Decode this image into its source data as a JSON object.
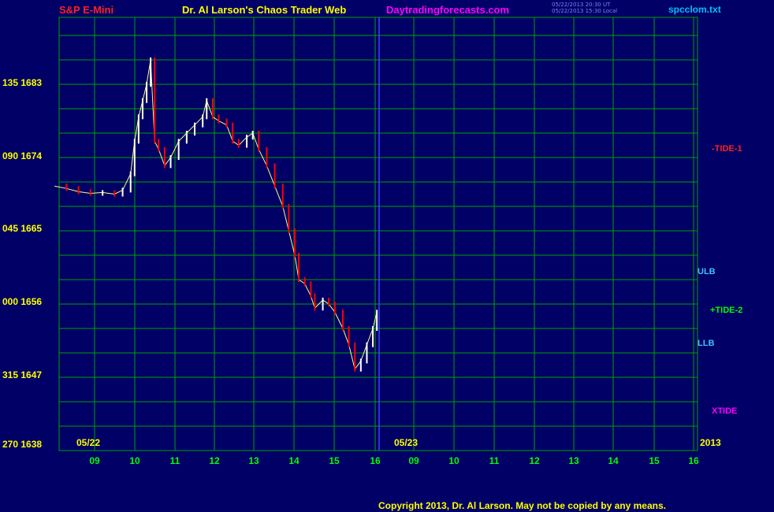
{
  "header": {
    "instrument": "S&P E-Mini",
    "title": "Dr. Al Larson's Chaos Trader Web",
    "site": "Daytradingforecasts.com",
    "timestamp_ut": "05/22/2013 20:30 UT",
    "timestamp_local": "05/22/2013 15:30 Local",
    "file": "spcclom.txt"
  },
  "copyright": "Copyright 2013, Dr. Al Larson. May not be copied by any means.",
  "colors": {
    "background": "#000066",
    "grid": "#00a000",
    "price_up": "#ffffff",
    "price_down": "#ff0000",
    "tide1": "#c00000",
    "tide2": "#00c000",
    "ulb_llb": "#40c0ff",
    "xtide": "#e040e0"
  },
  "chart_data": {
    "type": "line",
    "title": "S&P E-Mini",
    "y_labels": [
      {
        "label": "135 1683",
        "value": 1683
      },
      {
        "label": "090 1674",
        "value": 1674
      },
      {
        "label": "045 1665",
        "value": 1665
      },
      {
        "label": "000 1656",
        "value": 1656
      },
      {
        "label": "315 1647",
        "value": 1647
      },
      {
        "label": "270 1638",
        "value": 1638
      }
    ],
    "ylim": [
      1638,
      1690
    ],
    "x_ticks": [
      "09",
      "10",
      "11",
      "12",
      "13",
      "14",
      "15",
      "16",
      "09",
      "10",
      "11",
      "12",
      "13",
      "14",
      "15",
      "16"
    ],
    "date_labels": [
      "05/22",
      "05/23",
      "2013"
    ],
    "right_labels": [
      "-TIDE-1",
      "ULB",
      "+TIDE-2",
      "LLB",
      "XTIDE"
    ],
    "series": [
      {
        "name": "price",
        "points": [
          [
            8.0,
            1670.5
          ],
          [
            8.3,
            1670.2
          ],
          [
            8.6,
            1669.8
          ],
          [
            8.9,
            1669.6
          ],
          [
            9.2,
            1669.7
          ],
          [
            9.5,
            1669.5
          ],
          [
            9.7,
            1670
          ],
          [
            9.9,
            1672
          ],
          [
            10.0,
            1676
          ],
          [
            10.1,
            1679
          ],
          [
            10.2,
            1681
          ],
          [
            10.3,
            1683
          ],
          [
            10.4,
            1686
          ],
          [
            10.5,
            1676
          ],
          [
            10.6,
            1675
          ],
          [
            10.75,
            1673
          ],
          [
            10.9,
            1674
          ],
          [
            11.1,
            1676
          ],
          [
            11.3,
            1677
          ],
          [
            11.5,
            1678
          ],
          [
            11.7,
            1679
          ],
          [
            11.8,
            1681
          ],
          [
            11.95,
            1679
          ],
          [
            12.1,
            1678.5
          ],
          [
            12.3,
            1678
          ],
          [
            12.45,
            1676
          ],
          [
            12.6,
            1675.5
          ],
          [
            12.8,
            1676.5
          ],
          [
            12.95,
            1677
          ],
          [
            13.1,
            1675
          ],
          [
            13.3,
            1673
          ],
          [
            13.5,
            1670.5
          ],
          [
            13.7,
            1668
          ],
          [
            13.85,
            1665
          ],
          [
            14.0,
            1662
          ],
          [
            14.1,
            1659
          ],
          [
            14.25,
            1658.5
          ],
          [
            14.4,
            1657
          ],
          [
            14.5,
            1655.5
          ],
          [
            14.7,
            1656.5
          ],
          [
            14.85,
            1656
          ],
          [
            15.0,
            1655
          ],
          [
            15.2,
            1653
          ],
          [
            15.35,
            1651
          ],
          [
            15.5,
            1648
          ],
          [
            15.65,
            1649
          ],
          [
            15.8,
            1651
          ],
          [
            15.95,
            1653
          ],
          [
            16.05,
            1655
          ]
        ]
      },
      {
        "name": "-TIDE-1",
        "points": []
      },
      {
        "name": "+TIDE-2",
        "points": []
      },
      {
        "name": "ULB",
        "points": []
      },
      {
        "name": "LLB",
        "points": []
      },
      {
        "name": "XTIDE",
        "points": []
      }
    ]
  }
}
